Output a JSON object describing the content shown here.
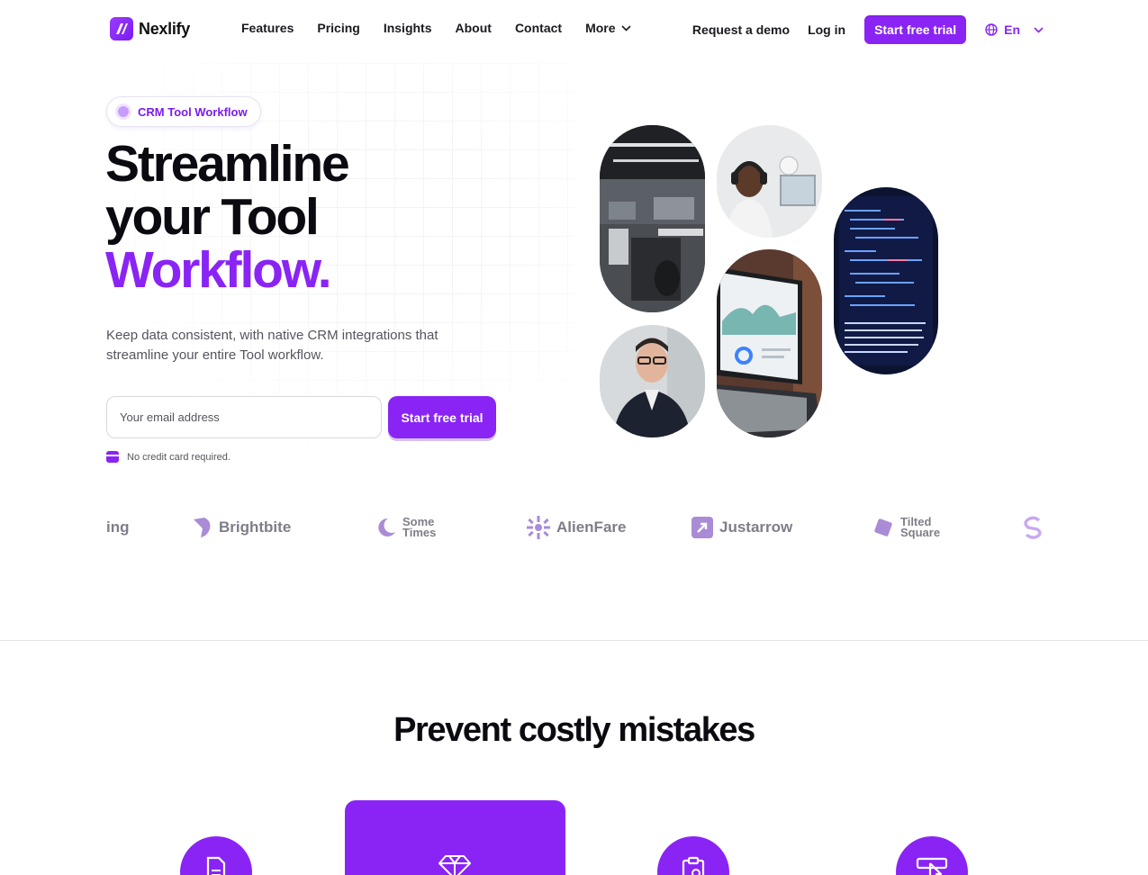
{
  "nav": {
    "brand": "Nexlify",
    "links": [
      "Features",
      "Pricing",
      "Insights",
      "About",
      "Contact"
    ],
    "more_label": "More",
    "request_demo": "Request a demo",
    "login": "Log in",
    "cta": "Start free trial",
    "language": "En"
  },
  "hero": {
    "badge": "CRM Tool Workflow",
    "headline_line1": "Streamline",
    "headline_line2": "your Tool",
    "headline_accent": "Workflow.",
    "subtext": "Keep data consistent, with native CRM integrations that streamline your entire Tool workflow.",
    "email_placeholder": "Your email address",
    "cta": "Start free trial",
    "note": "No credit card required."
  },
  "logos": {
    "partial_left": "ing",
    "brightbite": "Brightbite",
    "sometimes_1": "Some",
    "sometimes_2": "Times",
    "alienfare": "AlienFare",
    "justarrow": "Justarrow",
    "tilted_1": "Tilted",
    "tilted_2": "Square"
  },
  "section": {
    "title": "Prevent costly mistakes"
  },
  "colors": {
    "accent": "#8a24f5",
    "text": "#0a0a10",
    "muted": "#55555e"
  },
  "icons": [
    "globe-icon",
    "chevron-down-icon",
    "document-icon",
    "diamond-icon",
    "clipboard-icon",
    "cursor-icon",
    "card-icon"
  ]
}
